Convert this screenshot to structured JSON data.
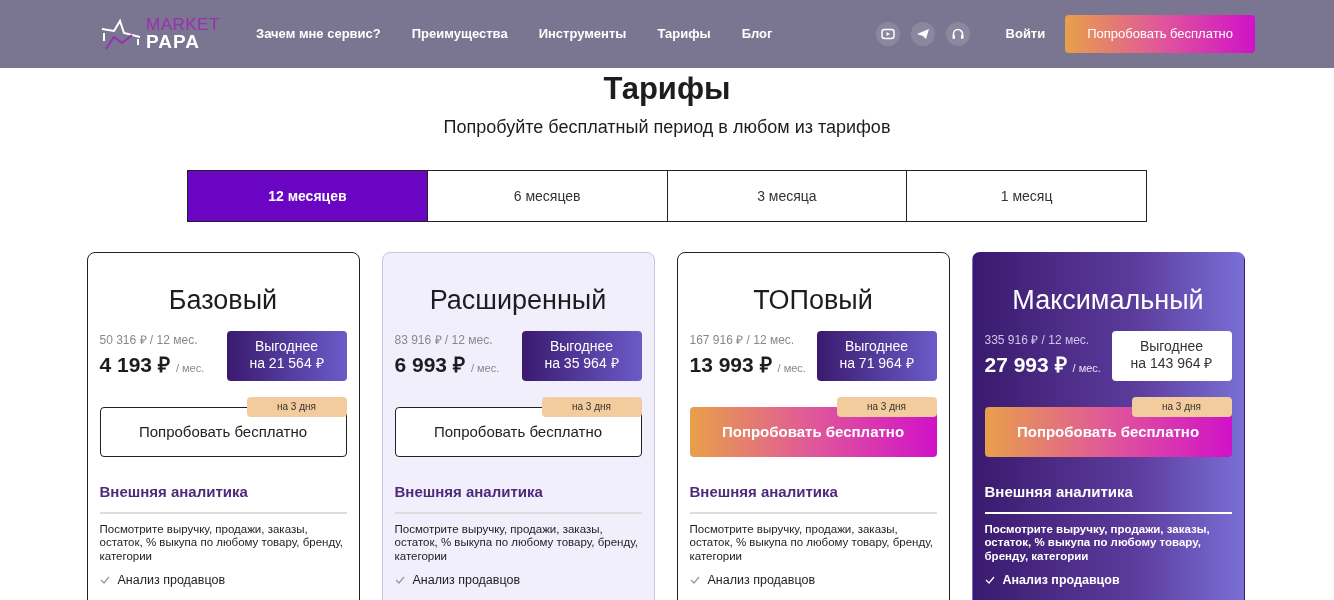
{
  "header": {
    "logo": {
      "top": "MARKET",
      "bottom": "PAPA"
    },
    "nav": [
      "Зачем мне сервис?",
      "Преимущества",
      "Инструменты",
      "Тарифы",
      "Блог"
    ],
    "social": [
      {
        "kind": "video"
      },
      {
        "kind": "send"
      },
      {
        "kind": "support"
      }
    ],
    "login": "Войти",
    "cta": "Попробовать бесплатно"
  },
  "title": "Тарифы",
  "subtitle": "Попробуйте бесплатный период в любом из тарифов",
  "periods": [
    {
      "label": "12 месяцев",
      "selected": true
    },
    {
      "label": "6 месяцев",
      "selected": false
    },
    {
      "label": "3 месяца",
      "selected": false
    },
    {
      "label": "1 месяц",
      "selected": false
    }
  ],
  "plans": [
    {
      "kind": "basic",
      "name": "Базовый",
      "total": "50 316 ₽ / 12 мес.",
      "price": "4 193 ₽",
      "per": "/ мес.",
      "saving": [
        "Выгоднее",
        "на 21 564 ₽"
      ],
      "trial_badge": "на 3 дня",
      "button": "Попробовать бесплатно",
      "section": "Внешняя аналитика",
      "description": "Посмотрите выручку, продажи, заказы, остаток, % выкупа по любому товару, бренду, категории",
      "features": [
        "Анализ продавцов"
      ]
    },
    {
      "kind": "tinted",
      "name": "Расширенный",
      "total": "83 916 ₽ / 12 мес.",
      "price": "6 993 ₽",
      "per": "/ мес.",
      "saving": [
        "Выгоднее",
        "на 35 964 ₽"
      ],
      "trial_badge": "на 3 дня",
      "button": "Попробовать бесплатно",
      "section": "Внешняя аналитика",
      "description": "Посмотрите выручку, продажи, заказы, остаток, % выкупа по любому товару, бренду, категории",
      "features": [
        "Анализ продавцов"
      ]
    },
    {
      "kind": "accent",
      "name": "ТОПовый",
      "total": "167 916 ₽ / 12 мес.",
      "price": "13 993 ₽",
      "per": "/ мес.",
      "saving": [
        "Выгоднее",
        "на 71 964 ₽"
      ],
      "trial_badge": "на 3 дня",
      "button": "Попробовать бесплатно",
      "section": "Внешняя аналитика",
      "description": "Посмотрите выручку, продажи, заказы, остаток, % выкупа по любому товару, бренду, категории",
      "features": [
        "Анализ продавцов"
      ]
    },
    {
      "kind": "dark",
      "name": "Максимальный",
      "total": "335 916 ₽ / 12 мес.",
      "price": "27 993 ₽",
      "per": "/ мес.",
      "saving": [
        "Выгоднее",
        "на 143 964 ₽"
      ],
      "trial_badge": "на 3 дня",
      "button": "Попробовать бесплатно",
      "section": "Внешняя аналитика",
      "description": "Посмотрите выручку, продажи, заказы, остаток, % выкупа по любому товару, бренду, категории",
      "features": [
        "Анализ продавцов"
      ]
    }
  ]
}
